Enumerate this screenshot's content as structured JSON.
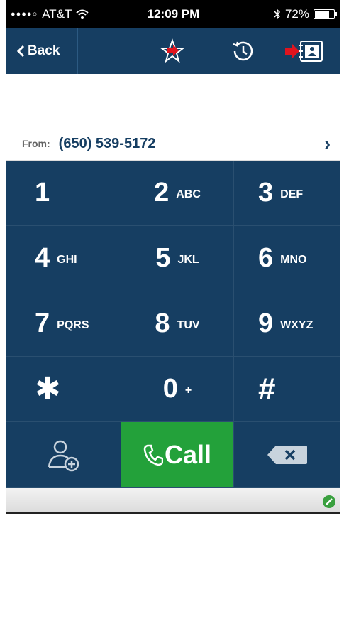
{
  "status_bar": {
    "carrier": "AT&T",
    "time": "12:09 PM",
    "battery": "72%",
    "battery_level": 0.72,
    "icons": [
      "signal-dots-icon",
      "wifi-icon",
      "bluetooth-icon",
      "battery-icon"
    ]
  },
  "nav": {
    "back_label": "Back",
    "icons": [
      "favorites-star-icon",
      "recents-clock-icon",
      "contacts-book-icon"
    ]
  },
  "from": {
    "label": "From:",
    "number": "(650) 539-5172"
  },
  "keypad": [
    {
      "digit": "1",
      "letters": ""
    },
    {
      "digit": "2",
      "letters": "ABC"
    },
    {
      "digit": "3",
      "letters": "DEF"
    },
    {
      "digit": "4",
      "letters": "GHI"
    },
    {
      "digit": "5",
      "letters": "JKL"
    },
    {
      "digit": "6",
      "letters": "MNO"
    },
    {
      "digit": "7",
      "letters": "PQRS"
    },
    {
      "digit": "8",
      "letters": "TUV"
    },
    {
      "digit": "9",
      "letters": "WXYZ"
    },
    {
      "digit": "✱",
      "letters": ""
    },
    {
      "digit": "0",
      "letters": "+"
    },
    {
      "digit": "#",
      "letters": ""
    }
  ],
  "actions": {
    "call_label": "Call",
    "icons": [
      "add-contact-icon",
      "phone-icon",
      "backspace-icon",
      "edit-check-icon"
    ]
  },
  "colors": {
    "nav_blue": "#163e62",
    "call_green": "#23a13a",
    "marker_red": "#e0141e"
  }
}
